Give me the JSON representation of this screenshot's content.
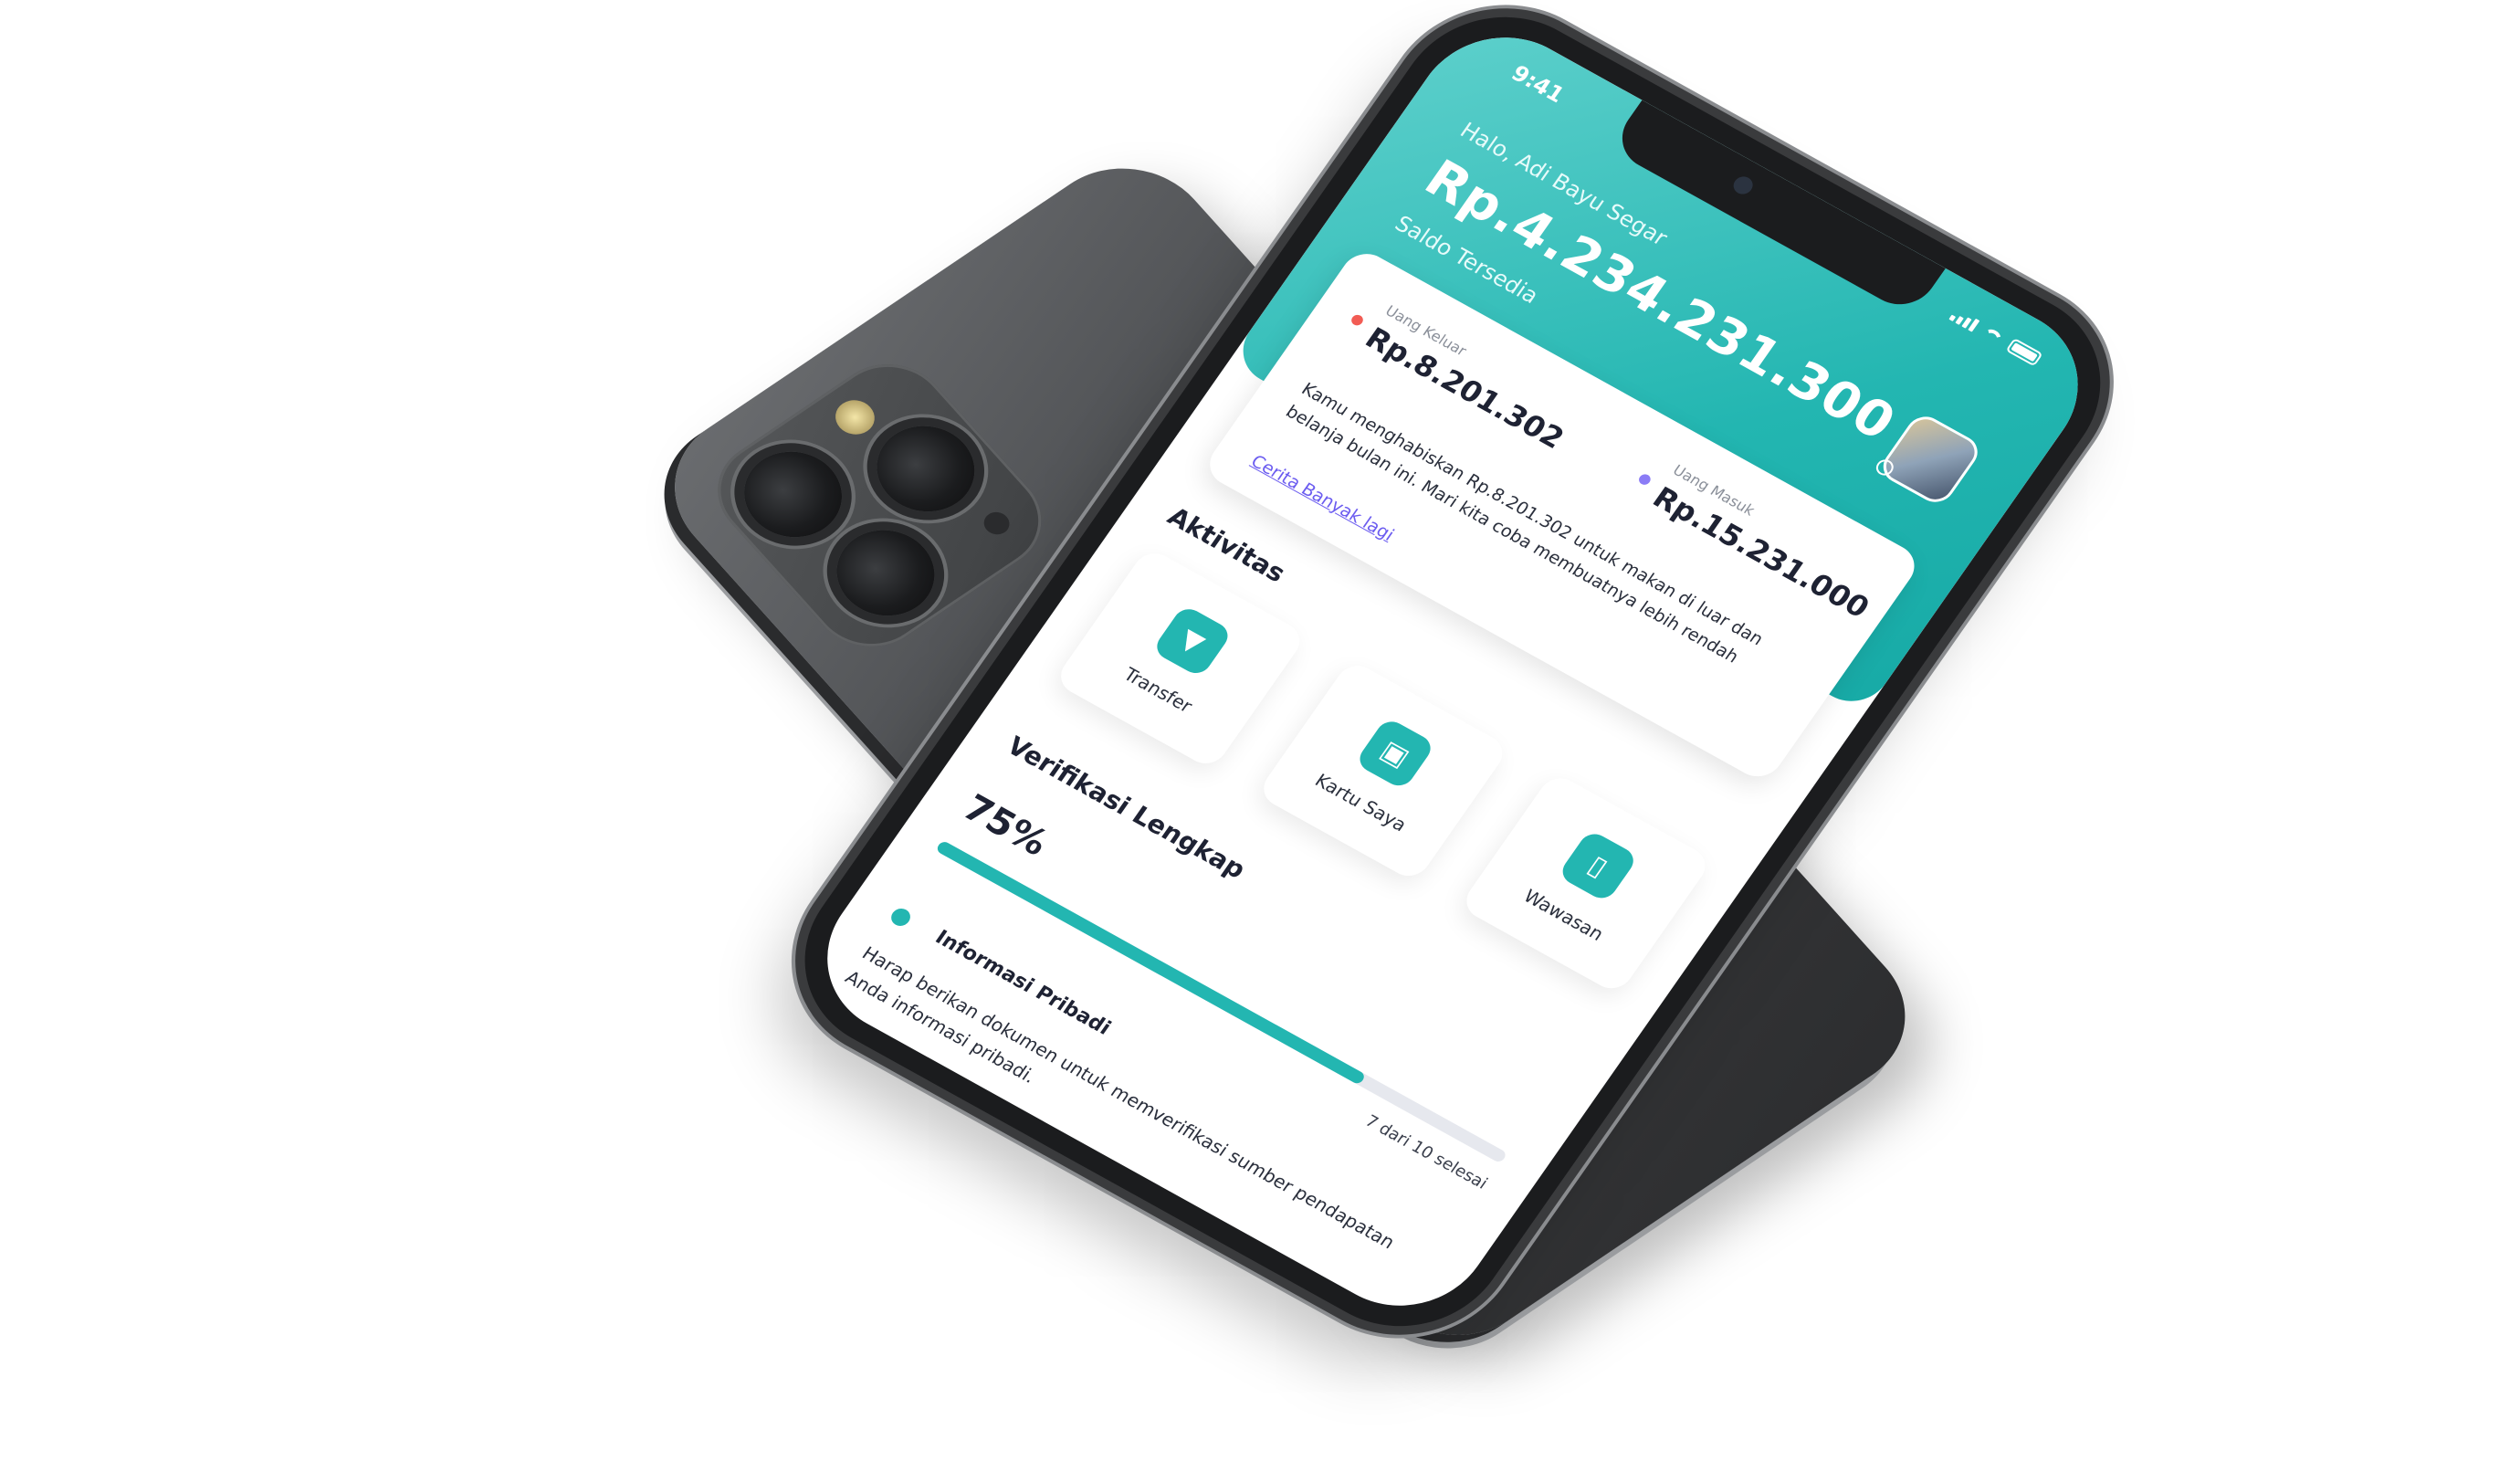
{
  "status_bar": {
    "time": "9:41"
  },
  "header": {
    "greeting": "Halo, Adi Bayu Segar",
    "balance": "Rp.4.234.231.300",
    "balance_label": "Saldo Tersedia"
  },
  "summary": {
    "money_out_label": "Uang Keluar",
    "money_out_amount": "Rp.8.201.302",
    "money_in_label": "Uang Masuk",
    "money_in_amount": "Rp.15.231.000",
    "story": "Kamu menghabiskan Rp.8.201.302 untuk makan di luar dan belanja bulan ini.  Mari kita coba membuatnya lebih rendah",
    "story_link": "Cerita Banyak lagi"
  },
  "activity": {
    "title": "Aktivitas",
    "items": [
      {
        "label": "Transfer",
        "icon": "transfer-icon"
      },
      {
        "label": "Kartu Saya",
        "icon": "card-icon"
      },
      {
        "label": "Wawasan",
        "icon": "chart-icon"
      }
    ]
  },
  "verification": {
    "title": "Verifikasi Lengkap",
    "percent_label": "75%",
    "progress": 0.75,
    "steps_label": "7 dari 10 selesai",
    "personal_title": "Informasi Pribadi",
    "personal_body": "Harap berikan dokumen untuk memverifikasi sumber pendapatan Anda informasi pribadi."
  },
  "colors": {
    "accent": "#23b6b1",
    "money_out_dot": "#f25c54",
    "money_in_dot": "#8b7cf6",
    "link": "#6b5cf0"
  }
}
